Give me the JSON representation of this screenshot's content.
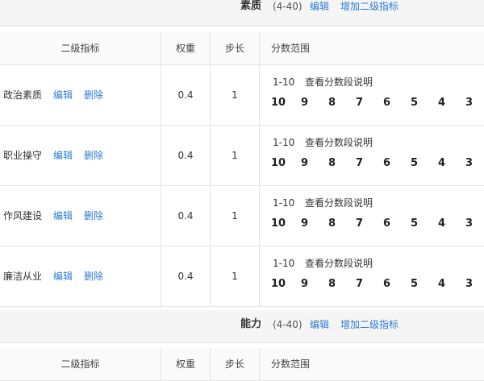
{
  "categories": [
    {
      "name": "素质",
      "range": "(4-40)",
      "edit_label": "编辑",
      "add_label": "增加二级指标",
      "table_headers": {
        "name": "二级指标",
        "weight": "权重",
        "step": "步长",
        "range": "分数范围"
      },
      "rows": [
        {
          "name": "政治素质",
          "edit": "编辑",
          "delete": "删除",
          "weight": "0.4",
          "step": "1",
          "range": "1-10",
          "explain": "查看分数段说明",
          "scores": [
            "10",
            "9",
            "8",
            "7",
            "6",
            "5",
            "4",
            "3"
          ]
        },
        {
          "name": "职业操守",
          "edit": "编辑",
          "delete": "删除",
          "weight": "0.4",
          "step": "1",
          "range": "1-10",
          "explain": "查看分数段说明",
          "scores": [
            "10",
            "9",
            "8",
            "7",
            "6",
            "5",
            "4",
            "3"
          ]
        },
        {
          "name": "作风建设",
          "edit": "编辑",
          "delete": "删除",
          "weight": "0.4",
          "step": "1",
          "range": "1-10",
          "explain": "查看分数段说明",
          "scores": [
            "10",
            "9",
            "8",
            "7",
            "6",
            "5",
            "4",
            "3"
          ]
        },
        {
          "name": "廉洁从业",
          "edit": "编辑",
          "delete": "删除",
          "weight": "0.4",
          "step": "1",
          "range": "1-10",
          "explain": "查看分数段说明",
          "scores": [
            "10",
            "9",
            "8",
            "7",
            "6",
            "5",
            "4",
            "3"
          ]
        }
      ]
    },
    {
      "name": "能力",
      "range": "(4-40)",
      "edit_label": "编辑",
      "add_label": "增加二级指标",
      "table_headers": {
        "name": "二级指标",
        "weight": "权重",
        "step": "步长",
        "range": "分数范围"
      }
    }
  ]
}
